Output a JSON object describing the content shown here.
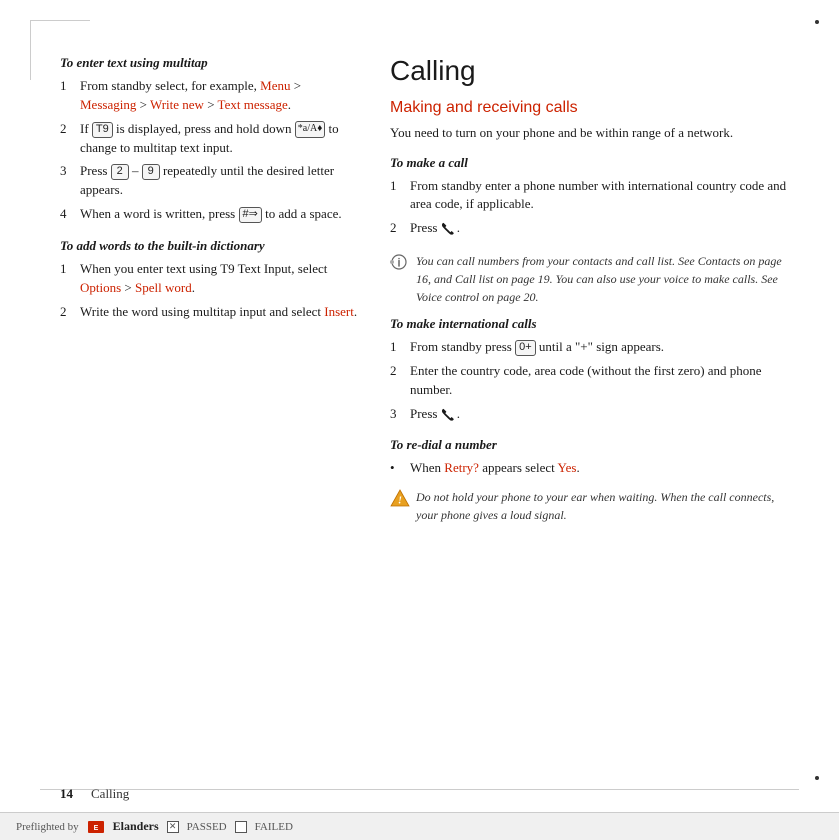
{
  "page": {
    "number": "14",
    "chapter": "Calling"
  },
  "decorations": {
    "top_left_border": true,
    "top_right_dot": true,
    "bottom_right_dot": true
  },
  "left_column": {
    "section1": {
      "heading": "To enter text using multitap",
      "steps": [
        {
          "num": "1",
          "parts": [
            {
              "text": "From standby select, for example, ",
              "type": "plain"
            },
            {
              "text": "Menu",
              "type": "link"
            },
            {
              "text": " > ",
              "type": "plain"
            },
            {
              "text": "Messaging",
              "type": "link"
            },
            {
              "text": " > ",
              "type": "plain"
            },
            {
              "text": "Write new",
              "type": "link"
            },
            {
              "text": " > ",
              "type": "plain"
            },
            {
              "text": "Text message",
              "type": "link"
            },
            {
              "text": ".",
              "type": "plain"
            }
          ]
        },
        {
          "num": "2",
          "parts": [
            {
              "text": "If ",
              "type": "plain"
            },
            {
              "text": "T9",
              "type": "key"
            },
            {
              "text": " is displayed, press and hold down ",
              "type": "plain"
            },
            {
              "text": "*a/A♦",
              "type": "key"
            },
            {
              "text": " to change to multitap text input.",
              "type": "plain"
            }
          ]
        },
        {
          "num": "3",
          "parts": [
            {
              "text": "Press ",
              "type": "plain"
            },
            {
              "text": "2",
              "type": "key"
            },
            {
              "text": " – ",
              "type": "plain"
            },
            {
              "text": "9",
              "type": "key"
            },
            {
              "text": " repeatedly until the desired letter appears.",
              "type": "plain"
            }
          ]
        },
        {
          "num": "4",
          "parts": [
            {
              "text": "When a word is written, press ",
              "type": "plain"
            },
            {
              "text": "#⇒",
              "type": "key"
            },
            {
              "text": " to add a space.",
              "type": "plain"
            }
          ]
        }
      ]
    },
    "section2": {
      "heading": "To add words to the built-in dictionary",
      "steps": [
        {
          "num": "1",
          "parts": [
            {
              "text": "When you enter text using T9 Text Input, select ",
              "type": "plain"
            },
            {
              "text": "Options",
              "type": "link"
            },
            {
              "text": " > ",
              "type": "plain"
            },
            {
              "text": "Spell word",
              "type": "link"
            },
            {
              "text": ".",
              "type": "plain"
            }
          ]
        },
        {
          "num": "2",
          "parts": [
            {
              "text": "Write the word using multitap input and select ",
              "type": "plain"
            },
            {
              "text": "Insert",
              "type": "link"
            },
            {
              "text": ".",
              "type": "plain"
            }
          ]
        }
      ]
    }
  },
  "right_column": {
    "title": "Calling",
    "section1": {
      "heading": "Making and receiving calls",
      "intro": "You need to turn on your phone and be within range of a network.",
      "subsection1": {
        "heading": "To make a call",
        "steps": [
          {
            "num": "1",
            "text": "From standby enter a phone number with international country code and area code, if applicable."
          },
          {
            "num": "2",
            "parts": [
              {
                "text": "Press ",
                "type": "plain"
              },
              {
                "text": "call",
                "type": "phone_icon"
              }
            ]
          }
        ]
      },
      "tip": {
        "text": "You can call numbers from your contacts and call list. See Contacts on page 16, and Call list on page 19. You can also use your voice to make calls. See Voice control on page 20."
      },
      "subsection2": {
        "heading": "To make international calls",
        "steps": [
          {
            "num": "1",
            "parts": [
              {
                "text": "From standby press ",
                "type": "plain"
              },
              {
                "text": "0+",
                "type": "key"
              },
              {
                "text": " until a \"+\" sign appears.",
                "type": "plain"
              }
            ]
          },
          {
            "num": "2",
            "text": "Enter the country code, area code (without the first zero) and phone number."
          },
          {
            "num": "3",
            "parts": [
              {
                "text": "Press ",
                "type": "plain"
              },
              {
                "text": "call",
                "type": "phone_icon"
              }
            ]
          }
        ]
      },
      "subsection3": {
        "heading": "To re-dial a number",
        "bullets": [
          {
            "parts": [
              {
                "text": "When ",
                "type": "plain"
              },
              {
                "text": "Retry?",
                "type": "link"
              },
              {
                "text": " appears select ",
                "type": "plain"
              },
              {
                "text": "Yes",
                "type": "link"
              },
              {
                "text": ".",
                "type": "plain"
              }
            ]
          }
        ]
      },
      "warning": {
        "text": "Do not hold your phone to your ear when waiting. When the call connects, your phone gives a loud signal."
      }
    }
  },
  "footer": {
    "preflight_label": "Preflighted by",
    "company": "Elanders",
    "passed_label": "PASSED",
    "failed_label": "FAILED"
  }
}
